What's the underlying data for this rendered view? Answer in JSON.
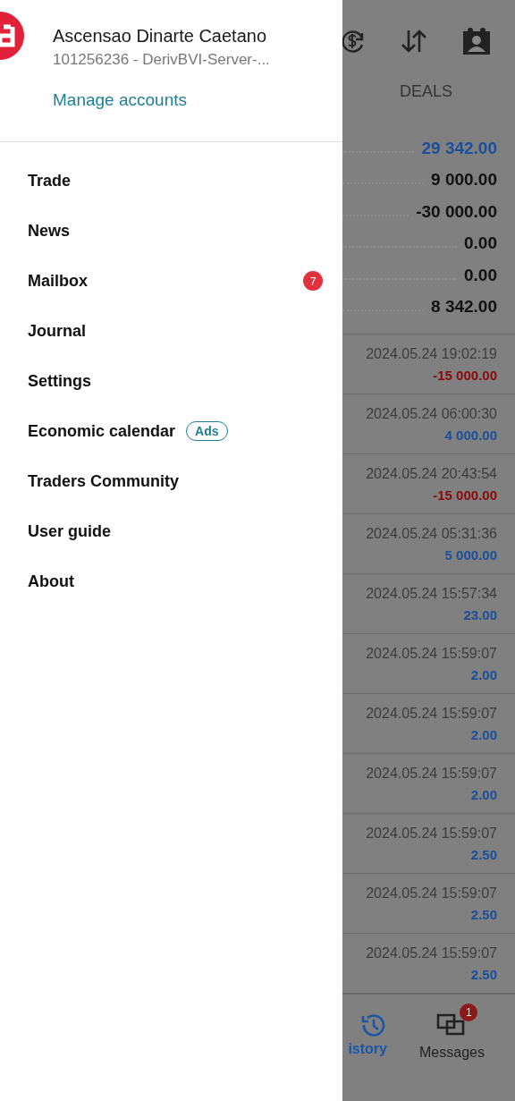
{
  "account": {
    "name": "Ascensao Dinarte Caetano",
    "server": "101256236 - DerivBVI-Server-...",
    "manage_link": "Manage accounts"
  },
  "menu": [
    {
      "label": "Trade"
    },
    {
      "label": "News"
    },
    {
      "label": "Mailbox",
      "badge": "7"
    },
    {
      "label": "Journal"
    },
    {
      "label": "Settings"
    },
    {
      "label": "Economic calendar",
      "tag": "Ads"
    },
    {
      "label": "Traders Community"
    },
    {
      "label": "User guide"
    },
    {
      "label": "About"
    }
  ],
  "history": {
    "tab": "DEALS",
    "summary": [
      {
        "value": "29 342.00",
        "highlight": true
      },
      {
        "value": "9 000.00",
        "highlight": false
      },
      {
        "value": "-30 000.00",
        "highlight": false
      },
      {
        "value": "0.00",
        "highlight": false
      },
      {
        "value": "0.00",
        "highlight": false
      },
      {
        "value": "8 342.00",
        "highlight": false
      }
    ],
    "deals": [
      {
        "time": "2024.05.24 19:02:19",
        "amount": "-15 000.00",
        "kind": "loss"
      },
      {
        "time": "2024.05.24 06:00:30",
        "amount": "4 000.00",
        "kind": "profit"
      },
      {
        "time": "2024.05.24 20:43:54",
        "amount": "-15 000.00",
        "kind": "loss"
      },
      {
        "time": "2024.05.24 05:31:36",
        "amount": "5 000.00",
        "kind": "profit"
      },
      {
        "time": "2024.05.24 15:57:34",
        "amount": "23.00",
        "kind": "profit"
      },
      {
        "time": "2024.05.24 15:59:07",
        "amount": "2.00",
        "kind": "profit"
      },
      {
        "time": "2024.05.24 15:59:07",
        "amount": "2.00",
        "kind": "profit"
      },
      {
        "time": "2024.05.24 15:59:07",
        "amount": "2.00",
        "kind": "profit"
      },
      {
        "time": "2024.05.24 15:59:07",
        "amount": "2.50",
        "kind": "profit"
      },
      {
        "time": "2024.05.24 15:59:07",
        "amount": "2.50",
        "kind": "profit"
      },
      {
        "time": "2024.05.24 15:59:07",
        "amount": "2.50",
        "kind": "profit"
      }
    ]
  },
  "bottom_nav": [
    {
      "label": "istory",
      "selected": true,
      "kind": "history"
    },
    {
      "label": "Messages",
      "selected": false,
      "kind": "messages",
      "badge": "1"
    }
  ]
}
